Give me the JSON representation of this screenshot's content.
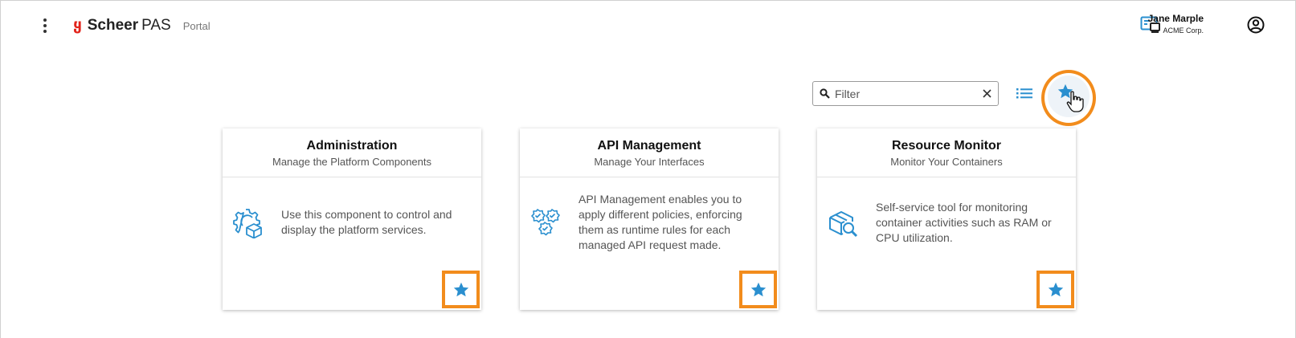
{
  "header": {
    "menu_icon": "more-vert-icon",
    "logo_mark": "ყ",
    "brand": "Scheer",
    "product": "PAS",
    "section": "Portal",
    "switch_icon": "view-switch-icon",
    "user": {
      "name": "Jane Marple",
      "org": "ACME Corp.",
      "icon": "account-circle-icon"
    }
  },
  "toolbar": {
    "filter_placeholder": "Filter",
    "filter_value": "",
    "search_icon": "search-icon",
    "clear_icon": "close-icon",
    "list_view_icon": "list-icon",
    "favorites_icon": "star-icon"
  },
  "cards": [
    {
      "title": "Administration",
      "subtitle": "Manage the Platform Components",
      "description": "Use this component to control and display the platform services.",
      "icon": "gear-cube-icon",
      "favorite": true
    },
    {
      "title": "API Management",
      "subtitle": "Manage Your Interfaces",
      "description": "API Management enables you to apply different policies, enforcing them as runtime rules for each managed API request made.",
      "icon": "shield-check-icon",
      "favorite": true
    },
    {
      "title": "Resource Monitor",
      "subtitle": "Monitor Your Containers",
      "description": "Self-service tool for monitoring container activities such as RAM or CPU utilization.",
      "icon": "container-search-icon",
      "favorite": true
    }
  ],
  "colors": {
    "accent": "#2a8fcf",
    "highlight": "#f28c1c",
    "brand_red": "#e2231a"
  }
}
